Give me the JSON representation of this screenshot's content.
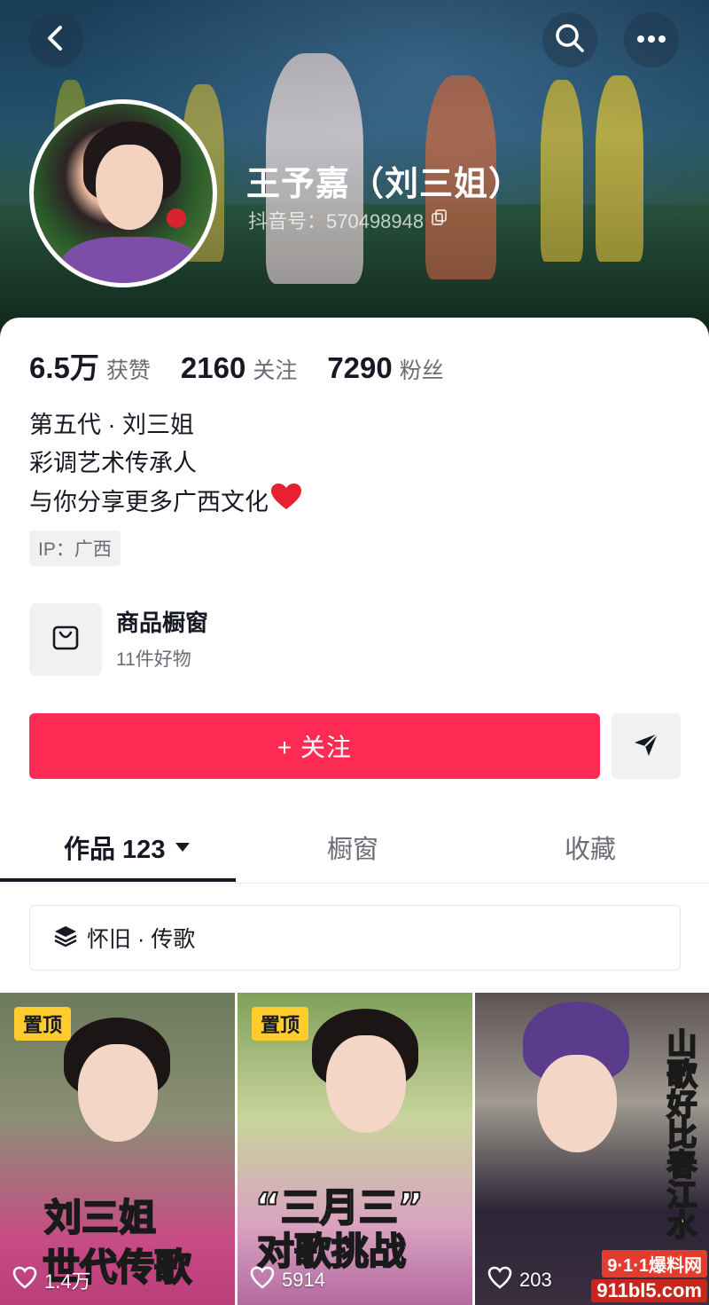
{
  "header": {
    "name": "王予嘉（刘三姐）",
    "douyin_id": "抖音号：570498948"
  },
  "stats": [
    {
      "value": "6.5万",
      "label": "获赞"
    },
    {
      "value": "2160",
      "label": "关注"
    },
    {
      "value": "7290",
      "label": "粉丝"
    }
  ],
  "bio": {
    "line1": "第五代 · 刘三姐",
    "line2": "彩调艺术传承人",
    "line3": "与你分享更多广西文化"
  },
  "ip_tag": "IP：广西",
  "shop": {
    "title": "商品橱窗",
    "subtitle": "11件好物"
  },
  "actions": {
    "follow_label": "+ 关注"
  },
  "tabs": [
    {
      "label": "作品 123",
      "active": true
    },
    {
      "label": "橱窗",
      "active": false
    },
    {
      "label": "收藏",
      "active": false
    }
  ],
  "collection": {
    "label": "怀旧 · 传歌"
  },
  "videos": [
    {
      "pinned": "置顶",
      "caption_line1": "刘三姐",
      "caption_line2": "世代传歌",
      "likes": "1.4万"
    },
    {
      "pinned": "置顶",
      "caption_line1": "“三月三”",
      "caption_line2": "对歌挑战",
      "likes": "5914"
    },
    {
      "caption": "山歌好比春江水",
      "likes": "203"
    }
  ],
  "watermark": {
    "line1": "9·1·1爆料网",
    "line2": "911bl5.com"
  },
  "colors": {
    "accent": "#fe2c55",
    "pin_badge": "#fecc2c",
    "text_primary": "#161823",
    "text_secondary": "#6b6d75"
  },
  "icons": {
    "back": "back-icon",
    "search": "search-icon",
    "more": "more-icon",
    "copy": "copy-icon",
    "heart": "heart-icon",
    "shop": "shopping-bag-icon",
    "share": "send-icon",
    "caret": "caret-down-icon",
    "collection": "layers-icon",
    "like": "like-icon"
  }
}
